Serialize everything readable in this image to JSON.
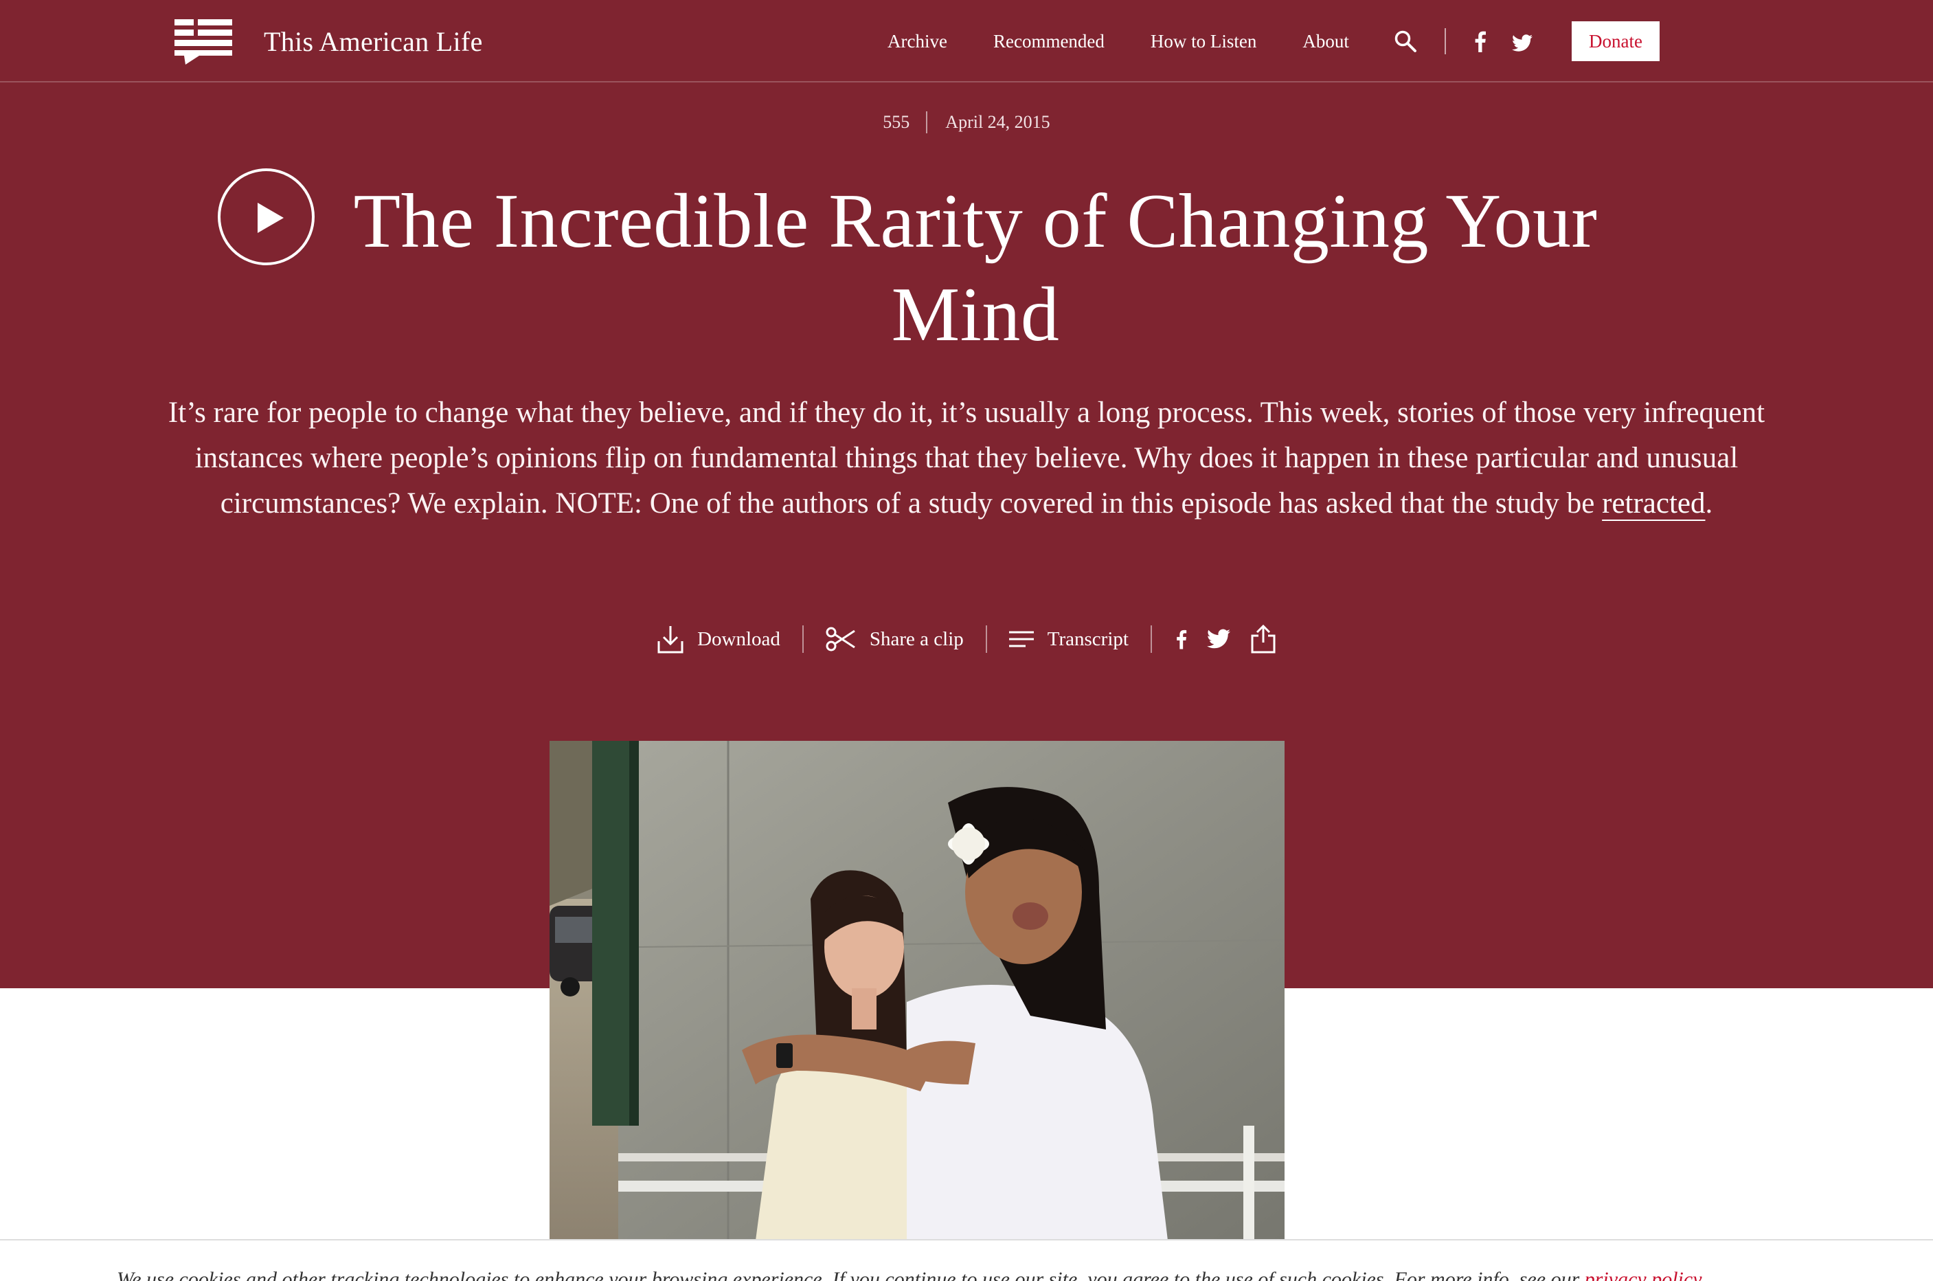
{
  "colors": {
    "brand": "#7f2430",
    "donate_text": "#c8102e",
    "white": "#ffffff"
  },
  "header": {
    "site_name": "This American Life",
    "nav": [
      "Archive",
      "Recommended",
      "How to Listen",
      "About"
    ],
    "icons": [
      "search-icon",
      "facebook-icon",
      "twitter-icon"
    ],
    "donate_label": "Donate"
  },
  "episode": {
    "number": "555",
    "date": "April 24, 2015",
    "title": "The Incredible Rarity of Changing Your Mind",
    "description_before_link": "It’s rare for people to change what they believe, and if they do it, it’s usually a long process. This week, stories of those very infrequent instances where people’s opinions flip on fundamental things that they believe. Why does it happen in these particular and unusual circumstances? We explain. NOTE: One of the authors of a study covered in this episode has asked that the study be ",
    "description_link": "retracted",
    "description_after_link": "."
  },
  "actions": {
    "download": "Download",
    "share_clip": "Share a clip",
    "transcript": "Transcript",
    "icons": [
      "download-icon",
      "scissors-icon",
      "transcript-icon",
      "facebook-icon",
      "twitter-icon",
      "share-icon"
    ]
  },
  "cookie": {
    "text": "We use cookies and other tracking technologies to enhance your browsing experience. If you continue to use our site, you agree to the use of such cookies. For more info, see our ",
    "link": "privacy policy"
  }
}
